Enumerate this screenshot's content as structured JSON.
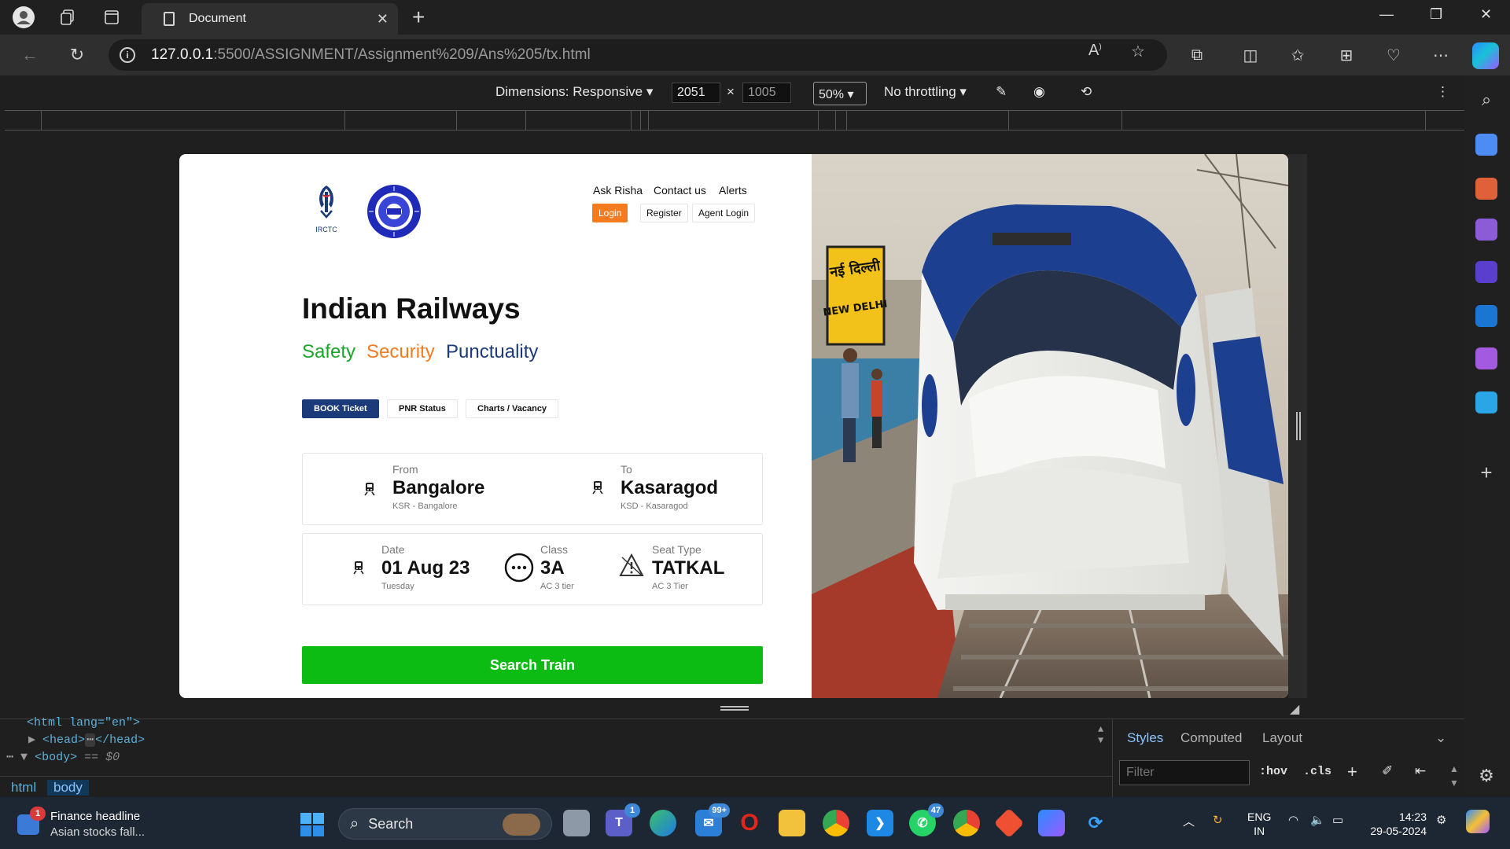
{
  "browser": {
    "tab_title": "Document",
    "url_host": "127.0.0.1",
    "url_rest": ":5500/ASSIGNMENT/Assignment%209/Ans%205/tx.html"
  },
  "device_toolbar": {
    "dimensions_label": "Dimensions: Responsive",
    "width": "2051",
    "height": "1005",
    "times": "×",
    "zoom": "50%",
    "throttling": "No throttling"
  },
  "page": {
    "logo_text": "IRCTC",
    "nav": {
      "ask": "Ask Risha",
      "contact": "Contact us",
      "alerts": "Alerts",
      "login": "Login",
      "register": "Register",
      "agent_login": "Agent Login"
    },
    "heading": "Indian Railways",
    "taglines": [
      "Safety",
      "Security",
      "Punctuality"
    ],
    "tagline_colors": [
      "#1aa52b",
      "#f47b20",
      "#1a3a7a"
    ],
    "tabs": [
      "BOOK Ticket",
      "PNR Status",
      "Charts / Vacancy"
    ],
    "from": {
      "label": "From",
      "value": "Bangalore",
      "sub": "KSR - Bangalore"
    },
    "to": {
      "label": "To",
      "value": "Kasaragod",
      "sub": "KSD - Kasaragod"
    },
    "date": {
      "label": "Date",
      "value": "01 Aug 23",
      "sub": "Tuesday"
    },
    "class": {
      "label": "Class",
      "value": "3A",
      "sub": "AC 3 tier"
    },
    "seat_type": {
      "label": "Seat Type",
      "value": "TATKAL",
      "sub": "AC 3 Tier"
    },
    "search_button": "Search Train",
    "station_sign_hindi": "नई दिल्ली",
    "station_sign_english": "NEW DELHI"
  },
  "devtools": {
    "dom_line1": "<html lang=\"en\">",
    "head_open": "<head>",
    "head_close": "</head>",
    "body_open": "<body>",
    "body_hint": "== $0",
    "crumbs": [
      "html",
      "body"
    ],
    "tabs": [
      "Styles",
      "Computed",
      "Layout"
    ],
    "filter_placeholder": "Filter",
    "hov": ":hov",
    "cls": ".cls"
  },
  "taskbar": {
    "widget_title": "Finance headline",
    "widget_sub": "Asian stocks fall...",
    "widget_badge": "1",
    "search_label": "Search",
    "badges": {
      "teams": "1",
      "mail": "99+",
      "whatsapp": "47"
    },
    "lang_top": "ENG",
    "lang_bottom": "IN",
    "time": "14:23",
    "date": "29-05-2024"
  }
}
